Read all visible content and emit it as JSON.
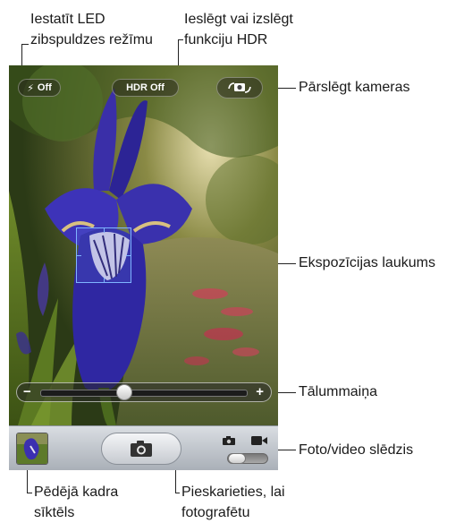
{
  "callouts": {
    "flash_line1": "Iestatīt LED",
    "flash_line2": "zibspuldzes režīmu",
    "hdr_line1": "Ieslēgt vai izslēgt",
    "hdr_line2": "funkciju HDR",
    "switch_camera": "Pārslēgt kameras",
    "exposure": "Ekspozīcijas laukums",
    "zoom": "Tālummaiņa",
    "photo_video": "Foto/video slēdzis",
    "last_frame_line1": "Pēdējā kadra",
    "last_frame_line2": "sīktēls",
    "tap_line1": "Pieskarieties, lai",
    "tap_line2": "fotografētu"
  },
  "camera": {
    "flash_label": "Off",
    "hdr_label": "HDR Off",
    "zoom_minus": "−",
    "zoom_plus": "+",
    "zoom_level": 0.4
  },
  "icons": [
    "lightning-bolt-icon",
    "camera-flip-icon",
    "camera-icon",
    "video-icon"
  ]
}
